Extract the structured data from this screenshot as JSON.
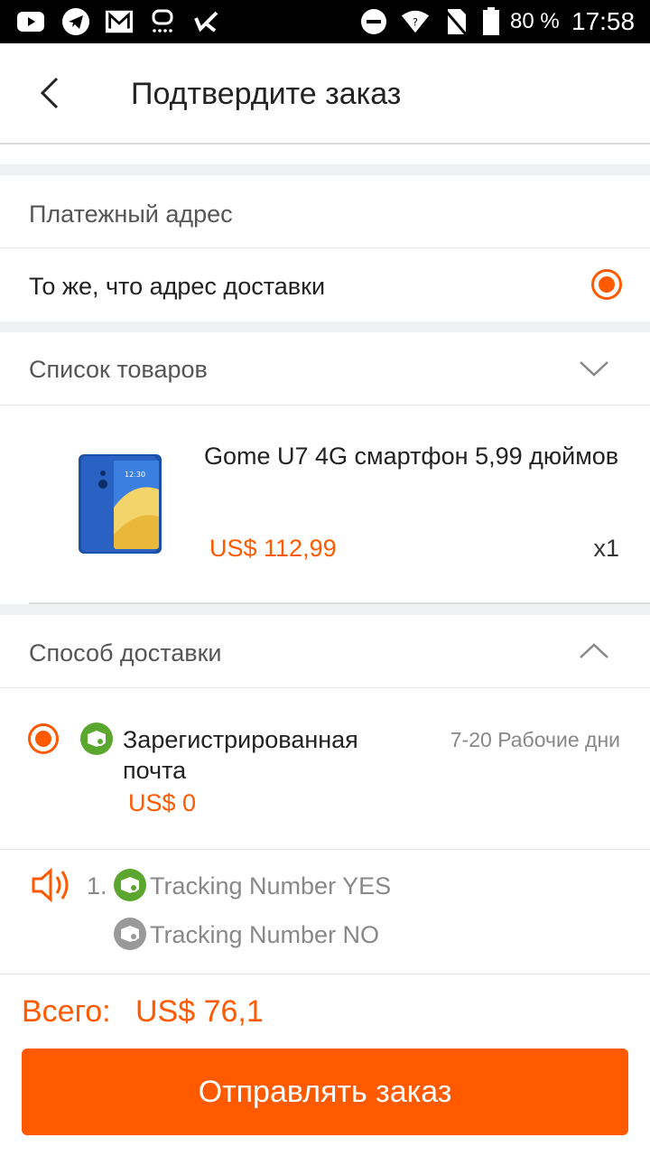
{
  "status_bar": {
    "battery": "80 %",
    "time": "17:58",
    "icons": [
      "youtube-icon",
      "telegram-icon",
      "mail-icon",
      "voicemail-icon",
      "checklist-icon",
      "do-not-disturb-icon",
      "wifi-icon",
      "no-sim-icon",
      "battery-icon"
    ]
  },
  "header": {
    "title": "Подтвердите заказ"
  },
  "billing": {
    "label": "Платежный адрес",
    "option": "То же, что адрес доставки"
  },
  "items": {
    "label": "Список товаров",
    "product": {
      "title": "Gome U7 4G смартфон 5,99 дюймов",
      "price": "US$ 112,99",
      "quantity": "x1"
    }
  },
  "shipping": {
    "label": "Способ доставки",
    "method_name": "Зарегистрированная почта",
    "days": "7-20 Рабочие дни",
    "price": "US$ 0"
  },
  "notes": {
    "number": "1.",
    "tracking_yes": "Tracking Number YES",
    "tracking_no": "Tracking Number NO"
  },
  "footer": {
    "total_label": "Всего:",
    "total_value": "US$ 76,1",
    "submit": "Отправлять заказ"
  },
  "colors": {
    "accent": "#ff5a00",
    "green_icon": "#5aa62e",
    "gray_icon": "#999999"
  }
}
